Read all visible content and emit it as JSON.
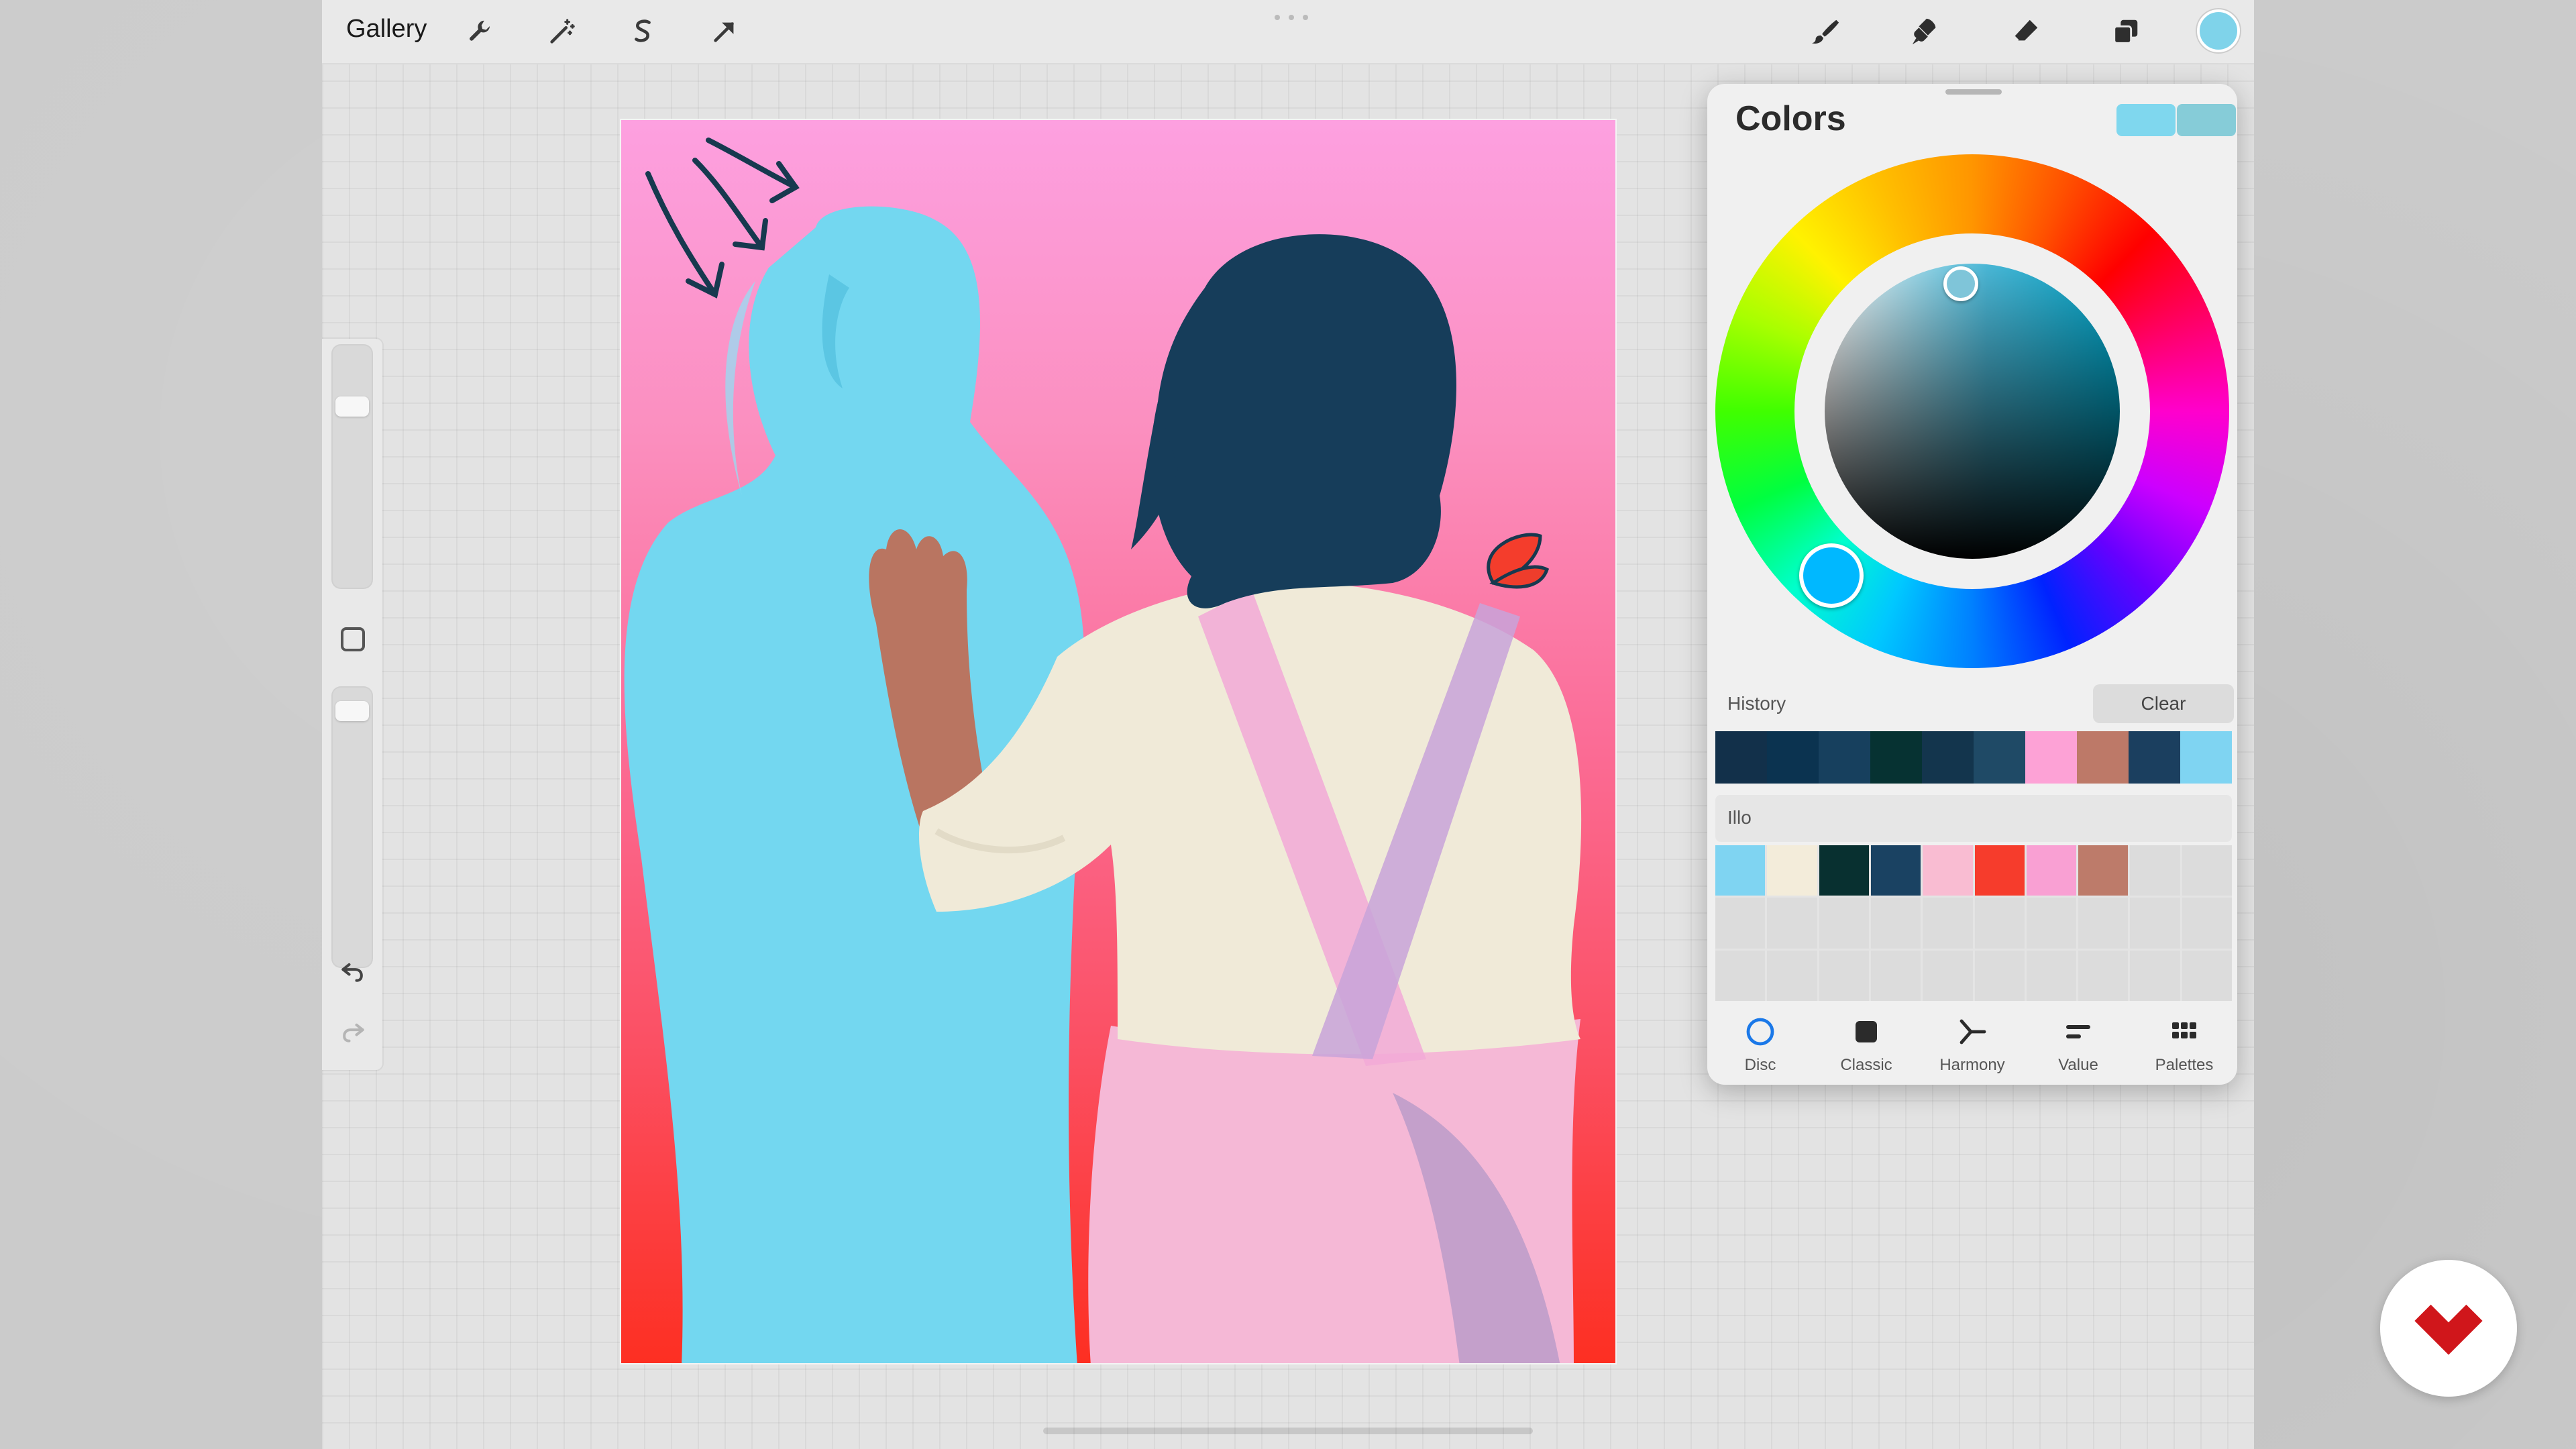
{
  "app": {
    "gallery_label": "Gallery",
    "toolbar_icons": [
      "wrench-icon",
      "magic-wand-icon",
      "selection-s-icon",
      "transform-arrow-icon"
    ],
    "right_tools": [
      "brush-icon",
      "smudge-icon",
      "eraser-icon",
      "layers-icon"
    ],
    "current_color": "#7fd3ea"
  },
  "colors_panel": {
    "title": "Colors",
    "current_swatches": [
      "#7fd7ee",
      "#86ccd8"
    ],
    "history_label": "History",
    "clear_label": "Clear",
    "history_colors": [
      "#12304a",
      "#0b3350",
      "#17405e",
      "#063232",
      "#13354d",
      "#1f4a66",
      "#fda2d6",
      "#bd7968",
      "#1b3f5f",
      "#7fd4f2"
    ],
    "palette_label": "Illo",
    "palette_colors": [
      "#7fd4f2",
      "#f3ecda",
      "#083030",
      "#1a4262",
      "#f9bcd2",
      "#f63c2c",
      "#f9a0d3",
      "#bd7b6a"
    ],
    "tabs": [
      {
        "label": "Disc",
        "icon": "disc-icon",
        "active": true
      },
      {
        "label": "Classic",
        "icon": "classic-icon",
        "active": false
      },
      {
        "label": "Harmony",
        "icon": "harmony-icon",
        "active": false
      },
      {
        "label": "Value",
        "icon": "value-icon",
        "active": false
      },
      {
        "label": "Palettes",
        "icon": "palettes-icon",
        "active": false
      }
    ]
  },
  "canvas": {
    "artwork": "two-figures-illustration"
  },
  "brand": {
    "icon": "domestika-logo-icon",
    "color": "#d0161b"
  }
}
